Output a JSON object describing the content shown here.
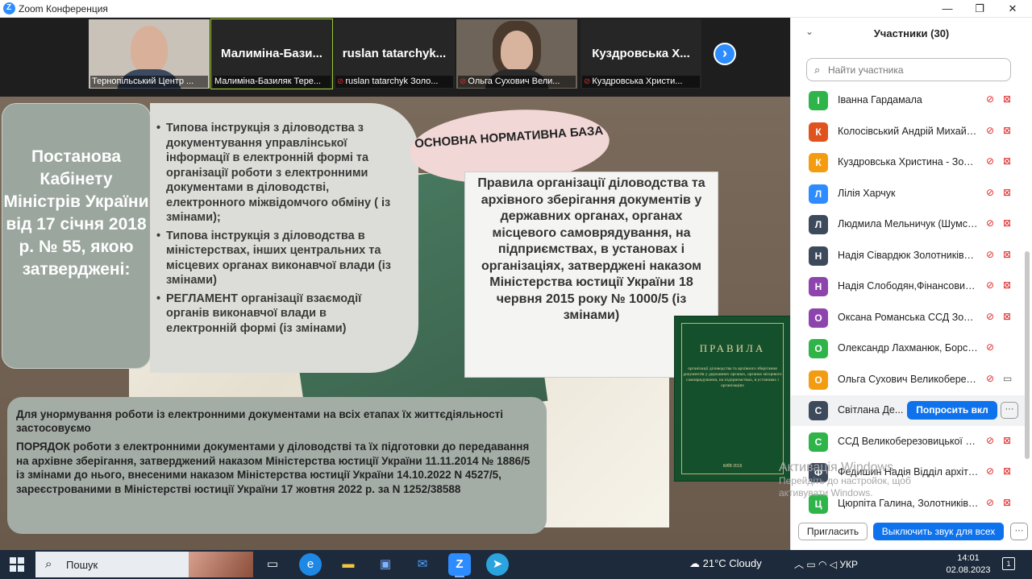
{
  "window": {
    "title": "Zoom Конференция",
    "min": "—",
    "max": "❐",
    "close": "✕"
  },
  "gallery": {
    "tiles": [
      {
        "big": "",
        "caption": "Тернопільський Центр ..."
      },
      {
        "big": "Малиміна-Бази...",
        "caption": "Малиміна-Базиляк Тере..."
      },
      {
        "big": "ruslan  tatarchyk...",
        "caption": "ruslan tatarchyk Золо..."
      },
      {
        "big": "",
        "caption": "Ольга Сухович Вели..."
      },
      {
        "big": "Куздровська  Х...",
        "caption": "Куздровська Христи..."
      }
    ],
    "next": "›"
  },
  "slide": {
    "left_title": "Постанова Кабінету Міністрів України від 17 січня 2018 р. № 55, якою затверджені:",
    "list": [
      "Типова інструкція з діловодства з документування управлінської інформації в електронній формі та організації роботи з електронними документами в діловодстві, електронного міжвідомчого обміну ( із змінами);",
      "Типова інструкція з діловодства в міністерствах, інших центральних та місцевих органах  виконавчої влади (із змінами)",
      "РЕГЛАМЕНТ організації взаємодії органів виконавчої влади в електронній формі (із змінами)"
    ],
    "oval": "ОСНОВНА НОРМАТИВНА БАЗА",
    "rules": "Правила організації діловодства та архівного зберігання документів у державних органах, органах місцевого самоврядування, на підприємствах, в установах і організаціях, затверджені наказом Міністерства юстиції України 18 червня 2015 року № 1000/5 (із змінами)",
    "book_title": "ПРАВИЛА",
    "book_sub": "організації діловодства та архівного зберігання документів у державних органах, органах місцевого самоврядування, на підприємствах, в установах і організаціях",
    "book_year": "КИЇВ 2015",
    "bottom_p1": "Для унормування роботи із електронними документами на всіх етапах їх життєдіяльності застосовуємо",
    "bottom_p2": "ПОРЯДОК роботи з електронними документами у діловодстві та їх підготовки до передавання на архівне зберігання, затверджений наказом Міністерства юстиції України 11.11.2014 № 1886/5 із змінами до нього, внесеними  наказом Міністерства юстиції України 14.10.2022 N 4527/5, зареєстрованими в Міністерстві юстиції України 17 жовтня 2022 р. за N 1252/38588"
  },
  "participants": {
    "title": "Участники (30)",
    "search_placeholder": "Найти участника",
    "items": [
      {
        "initial": "І",
        "color": "#2fb44a",
        "name": "Іванна Гардамала"
      },
      {
        "initial": "К",
        "color": "#e0521e",
        "name": "Колосівський Андрій Михайло..."
      },
      {
        "initial": "К",
        "color": "#f39c12",
        "name": "Куздровська Христина - Золо..."
      },
      {
        "initial": "Л",
        "color": "#2d8cff",
        "name": "Лілія Харчук"
      },
      {
        "initial": "Л",
        "color": "#3d4a5c",
        "name": "Людмила Мельничук (Шумськ)"
      },
      {
        "initial": "Н",
        "color": "#3d4a5c",
        "name": "Надія Сівардюк Золотниківськ..."
      },
      {
        "initial": "Н",
        "color": "#8e44ad",
        "name": "Надія Слободян,Фінансовий ві..."
      },
      {
        "initial": "О",
        "color": "#8e44ad",
        "name": "Оксана Романська ССД Золотникі..."
      },
      {
        "initial": "О",
        "color": "#2fb44a",
        "name": "Олександр Лахманюк, Борсуківсь..."
      },
      {
        "initial": "О",
        "color": "#f39c12",
        "name": "Ольга Сухович Великоберезо..."
      },
      {
        "initial": "С",
        "color": "#3d4a5c",
        "name": "Світлана Де..."
      },
      {
        "initial": "С",
        "color": "#2fb44a",
        "name": "ССД Великоберезовицької се..."
      },
      {
        "initial": "Ф",
        "color": "#3d4a5c",
        "name": "Федишин Надія Відділ архітектури,..."
      },
      {
        "initial": "Ц",
        "color": "#2fb44a",
        "name": "Цюрпіта Галина, Золотниківсь..."
      }
    ],
    "ask_label": "Попросить вкл",
    "more": "···",
    "invite": "Пригласить",
    "unmute_all": "Выключить звук для всех"
  },
  "watermark": {
    "line1": "Активація Windows",
    "line2": "Перейдіть до настройок, щоб",
    "line3": "активувати Windows."
  },
  "taskbar": {
    "search": "Пошук",
    "weather": "21°C  Cloudy",
    "lang": "УКР",
    "time": "14:01",
    "date": "02.08.2023",
    "notif": "1"
  },
  "icons": {
    "search": "search-icon",
    "mic_off": "mic-off-icon",
    "cam_off": "camera-off-icon"
  }
}
